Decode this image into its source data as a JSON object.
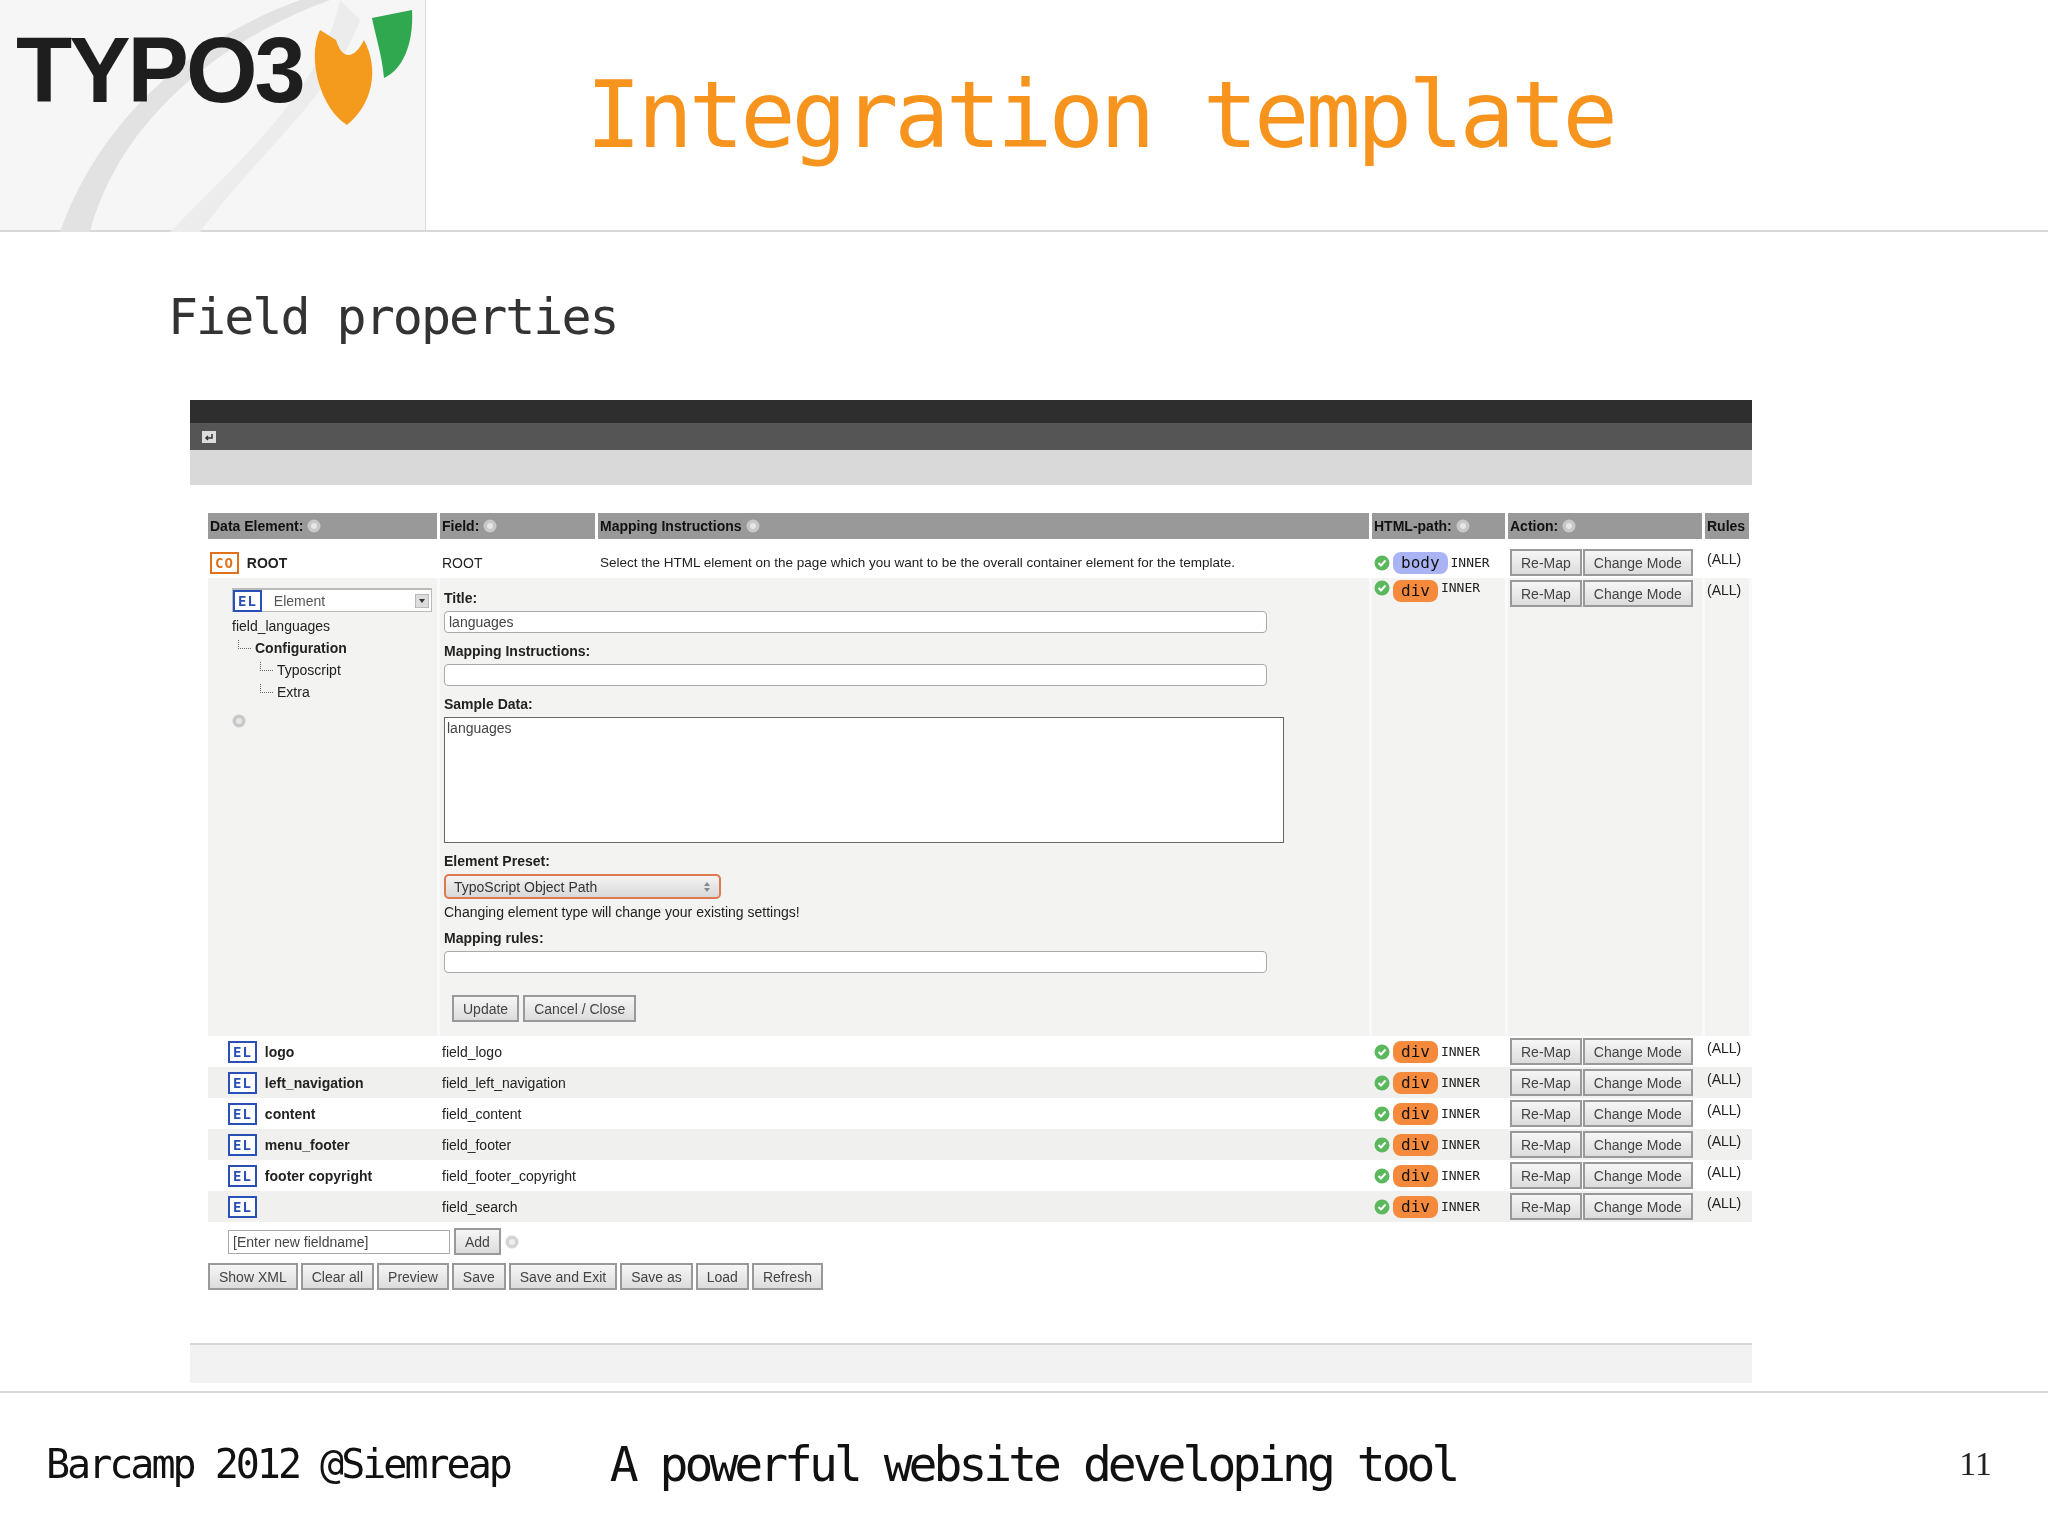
{
  "slide": {
    "logo": {
      "text": "TYPO3"
    },
    "title": "Integration template",
    "subtitle": "Field properties",
    "footer": {
      "event": "Barcamp 2012 @Siemreap",
      "tagline": "A powerful website developing tool",
      "page_number": "11"
    }
  },
  "screenshot": {
    "columns": [
      {
        "label": "Data Element:",
        "help": true
      },
      {
        "label": "Field:",
        "help": true
      },
      {
        "label": "Mapping Instructions",
        "help": true
      },
      {
        "label": "HTML-path:",
        "help": true
      },
      {
        "label": "Action:",
        "help": true
      },
      {
        "label": "Rules"
      }
    ],
    "rows": [
      {
        "kind": "root",
        "badge": "CO",
        "name": "ROOT",
        "field": "ROOT",
        "instructions": "Select the HTML element on the page which you want to be the overall container element for the template.",
        "mapped": true,
        "tag": {
          "label": "body",
          "color": "#aab4f5"
        },
        "mode": "INNER",
        "actions": [
          "Re-Map",
          "Change Mode"
        ],
        "rules": "(ALL)"
      },
      {
        "kind": "editing",
        "badge": "EL",
        "type": "Element",
        "tree": {
          "label": "field_languages",
          "children": [
            {
              "label": "Configuration",
              "children": [
                {
                  "label": "Typoscript"
                },
                {
                  "label": "Extra"
                }
              ]
            }
          ]
        },
        "form": [
          {
            "kind": "input",
            "label": "Title:",
            "value": "languages"
          },
          {
            "kind": "input",
            "label": "Mapping Instructions:"
          },
          {
            "kind": "textarea",
            "label": "Sample Data:",
            "value": "languages"
          },
          {
            "kind": "select",
            "label": "Element Preset:",
            "value": "TypoScript Object Path",
            "note": "Changing element type will change your existing settings!"
          },
          {
            "kind": "input",
            "label": "Mapping rules:"
          }
        ],
        "form_buttons": [
          "Update",
          "Cancel / Close"
        ],
        "mapped": true,
        "tag": {
          "label": "div",
          "color": "#f58a3c"
        },
        "mode": "INNER",
        "actions": [
          "Re-Map",
          "Change Mode"
        ],
        "rules": "(ALL)"
      },
      {
        "kind": "element",
        "badge": "EL",
        "name": "logo",
        "field": "field_logo",
        "mapped": true,
        "tag": {
          "label": "div",
          "color": "#f58a3c"
        },
        "mode": "INNER",
        "actions": [
          "Re-Map",
          "Change Mode"
        ],
        "rules": "(ALL)"
      },
      {
        "kind": "element",
        "badge": "EL",
        "name": "left_navigation",
        "field": "field_left_navigation",
        "mapped": true,
        "tag": {
          "label": "div",
          "color": "#f58a3c"
        },
        "mode": "INNER",
        "actions": [
          "Re-Map",
          "Change Mode"
        ],
        "rules": "(ALL)"
      },
      {
        "kind": "element",
        "badge": "EL",
        "name": "content",
        "field": "field_content",
        "mapped": true,
        "tag": {
          "label": "div",
          "color": "#f58a3c"
        },
        "mode": "INNER",
        "actions": [
          "Re-Map",
          "Change Mode"
        ],
        "rules": "(ALL)"
      },
      {
        "kind": "element",
        "badge": "EL",
        "name": "menu_footer",
        "field": "field_footer",
        "mapped": true,
        "tag": {
          "label": "div",
          "color": "#f58a3c"
        },
        "mode": "INNER",
        "actions": [
          "Re-Map",
          "Change Mode"
        ],
        "rules": "(ALL)"
      },
      {
        "kind": "element",
        "badge": "EL",
        "name": "footer copyright",
        "field": "field_footer_copyright",
        "mapped": true,
        "tag": {
          "label": "div",
          "color": "#f58a3c"
        },
        "mode": "INNER",
        "actions": [
          "Re-Map",
          "Change Mode"
        ],
        "rules": "(ALL)"
      },
      {
        "kind": "element",
        "badge": "EL",
        "field": "field_search",
        "mapped": true,
        "tag": {
          "label": "div",
          "color": "#f58a3c"
        },
        "mode": "INNER",
        "actions": [
          "Re-Map",
          "Change Mode"
        ],
        "rules": "(ALL)"
      }
    ],
    "new_field": {
      "value": "[Enter new fieldname]",
      "button": "Add"
    },
    "buttons": [
      "Show XML",
      "Clear all",
      "Preview",
      "Save",
      "Save and Exit",
      "Save as",
      "Load",
      "Refresh"
    ]
  }
}
